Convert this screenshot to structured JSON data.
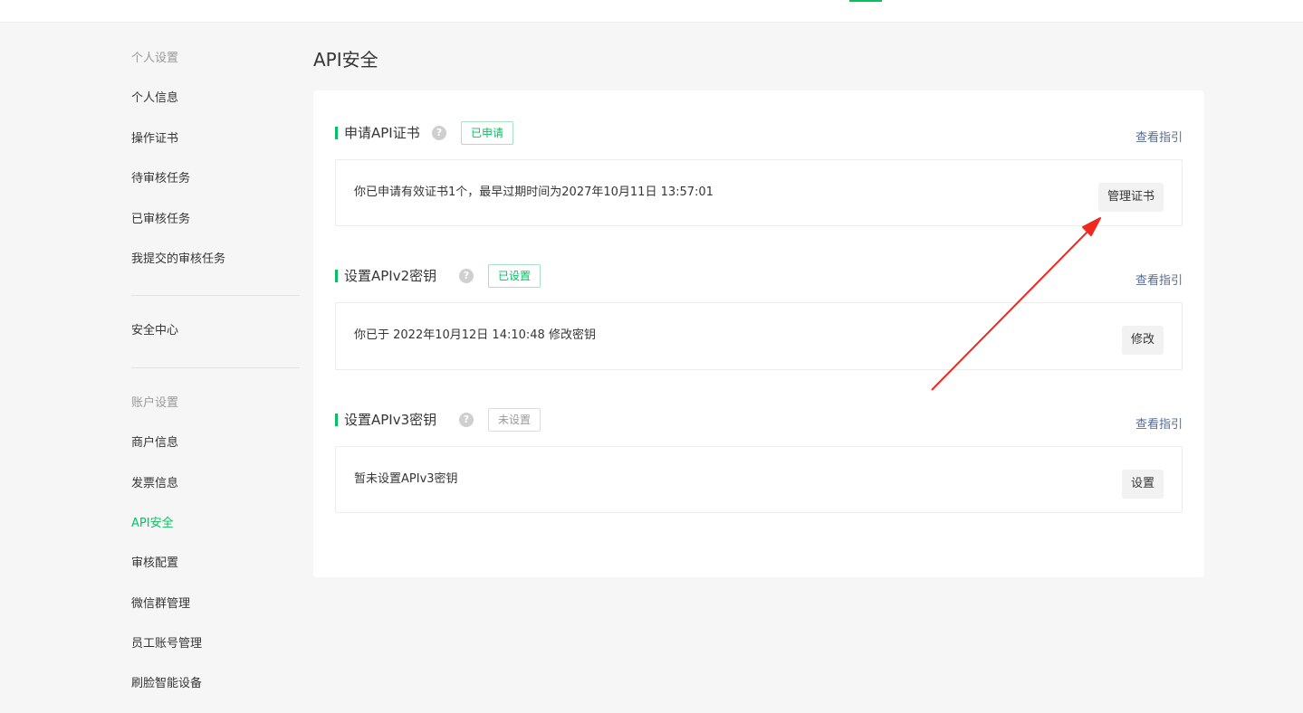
{
  "sidebar": {
    "personal_title": "个人设置",
    "personal_items": [
      {
        "label": "个人信息"
      },
      {
        "label": "操作证书"
      },
      {
        "label": "待审核任务"
      },
      {
        "label": "已审核任务"
      },
      {
        "label": "我提交的审核任务"
      }
    ],
    "security_center": "安全中心",
    "account_title": "账户设置",
    "account_items": [
      {
        "label": "商户信息"
      },
      {
        "label": "发票信息"
      },
      {
        "label": "API安全",
        "active": true
      },
      {
        "label": "审核配置"
      },
      {
        "label": "微信群管理"
      },
      {
        "label": "员工账号管理"
      },
      {
        "label": "刷脸智能设备"
      }
    ]
  },
  "main": {
    "title": "API安全",
    "sections": [
      {
        "title": "申请API证书",
        "help_icon": "question-mark-icon",
        "badge": "已申请",
        "guide_link": "查看指引",
        "text": "你已申请有效证书1个，最早过期时间为2027年10月11日 13:57:01",
        "button": "管理证书"
      },
      {
        "title": "设置APIv2密钥",
        "help_icon": "question-mark-icon",
        "badge": "已设置",
        "guide_link": "查看指引",
        "text": "你已于 2022年10月12日 14:10:48 修改密钥",
        "button": "修改"
      },
      {
        "title": "设置APIv3密钥",
        "help_icon": "question-mark-icon",
        "badge": "未设置",
        "guide_link": "查看指引",
        "text": "暂未设置APIv3密钥",
        "button": "设置"
      }
    ]
  },
  "help_glyph": "?",
  "colors": {
    "accent": "#07c160",
    "link": "#576b95",
    "annotation_arrow": "#f0281e"
  }
}
